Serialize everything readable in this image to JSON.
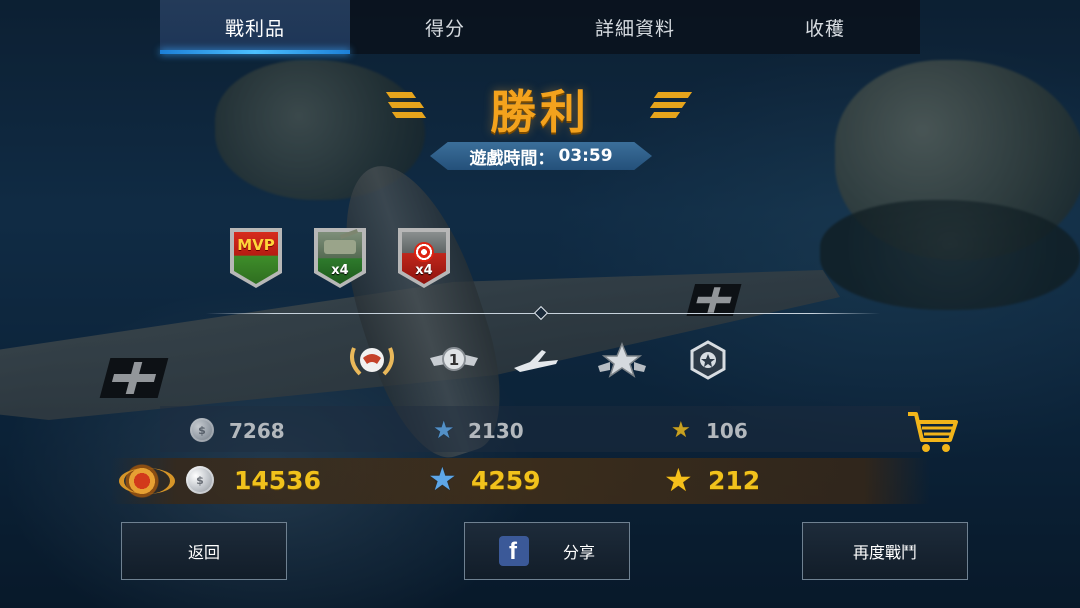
{
  "tabs": [
    {
      "label": "戰利品",
      "active": true
    },
    {
      "label": "得分",
      "active": false
    },
    {
      "label": "詳細資料",
      "active": false
    },
    {
      "label": "收穫",
      "active": false
    }
  ],
  "header": {
    "title": "勝利",
    "time_label": "遊戲時間：",
    "time_value": "03:59"
  },
  "medals": [
    {
      "name": "mvp",
      "label": "MVP"
    },
    {
      "name": "tank-kill",
      "count": "x4"
    },
    {
      "name": "target-hit",
      "count": "x4"
    }
  ],
  "badges": [
    {
      "name": "wreath-eagle-badge"
    },
    {
      "name": "rank-1-wings-badge",
      "number": "1"
    },
    {
      "name": "plane-badge"
    },
    {
      "name": "star-ribbon-badge"
    },
    {
      "name": "hexagon-star-badge"
    }
  ],
  "rewards": {
    "base": {
      "silver": "7268",
      "blue_stars": "2130",
      "gold_stars": "106"
    },
    "total": {
      "silver": "14536",
      "blue_stars": "4259",
      "gold_stars": "212"
    }
  },
  "buttons": {
    "back": "返回",
    "share": "分享",
    "again": "再度戰鬥"
  },
  "icons": {
    "facebook": "f"
  },
  "colors": {
    "victory": "#f3a21d",
    "reward_gold": "#f1c21c",
    "tab_active_accent": "#3aa7ff",
    "facebook_blue": "#3b5998"
  }
}
